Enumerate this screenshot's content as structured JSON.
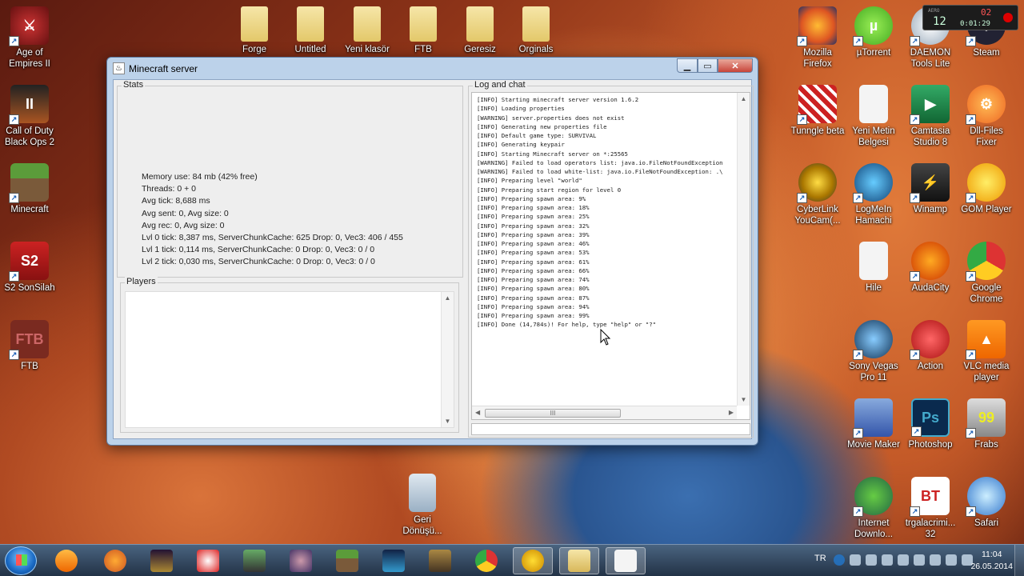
{
  "desktop": {
    "left_icons": [
      "Age of Empires II",
      "Call of Duty Black Ops 2",
      "Minecraft",
      "S2 SonSilah",
      "FTB"
    ],
    "top_folders": [
      "Forge",
      "Untitled",
      "Yeni klasör",
      "FTB",
      "Geresiz",
      "Orginals"
    ],
    "right_icons": [
      "Mozilla Firefox",
      "µTorrent",
      "DAEMON Tools Lite",
      "Steam",
      "Tunngle beta",
      "Yeni Metin Belgesi",
      "Camtasia Studio 8",
      "Dll-Files Fixer",
      "CyberLink YouCam(...",
      "LogMeIn Hamachi",
      "Winamp",
      "GOM Player",
      "Hile",
      "AudaCity",
      "Google Chrome",
      "Sony Vegas Pro 11",
      "Action",
      "VLC media player",
      "Movie Maker",
      "Photoshop",
      "Frabs",
      "Internet Downlo...",
      "trgalacrimi... 32",
      "Safari"
    ],
    "recycle_bin": "Geri Dönüşü..."
  },
  "recorder": {
    "label": "AERO",
    "fps": "12",
    "seconds": "02",
    "time": "0:01:29"
  },
  "window": {
    "title": "Minecraft server",
    "stats_label": "Stats",
    "stats": [
      "Memory use: 84 mb (42% free)",
      "Threads: 0 + 0",
      "Avg tick: 8,688 ms",
      "Avg sent: 0, Avg size: 0",
      "Avg rec: 0, Avg size: 0",
      "Lvl 0 tick: 8,387 ms, ServerChunkCache: 625 Drop: 0, Vec3: 406 / 455",
      "Lvl 1 tick: 0,114 ms, ServerChunkCache: 0 Drop: 0, Vec3: 0 / 0",
      "Lvl 2 tick: 0,030 ms, ServerChunkCache: 0 Drop: 0, Vec3: 0 / 0"
    ],
    "players_label": "Players",
    "log_label": "Log and chat",
    "log": [
      "[INFO] Starting minecraft server version 1.6.2",
      "[INFO] Loading properties",
      "[WARNING] server.properties does not exist",
      "[INFO] Generating new properties file",
      "[INFO] Default game type: SURVIVAL",
      "[INFO] Generating keypair",
      "[INFO] Starting Minecraft server on *:25565",
      "[WARNING] Failed to load operators list: java.io.FileNotFoundException",
      "[WARNING] Failed to load white-list: java.io.FileNotFoundException: .\\",
      "[INFO] Preparing level \"world\"",
      "[INFO] Preparing start region for level 0",
      "[INFO] Preparing spawn area: 9%",
      "[INFO] Preparing spawn area: 18%",
      "[INFO] Preparing spawn area: 25%",
      "[INFO] Preparing spawn area: 32%",
      "[INFO] Preparing spawn area: 39%",
      "[INFO] Preparing spawn area: 46%",
      "[INFO] Preparing spawn area: 53%",
      "[INFO] Preparing spawn area: 61%",
      "[INFO] Preparing spawn area: 66%",
      "[INFO] Preparing spawn area: 74%",
      "[INFO] Preparing spawn area: 80%",
      "[INFO] Preparing spawn area: 87%",
      "[INFO] Preparing spawn area: 94%",
      "[INFO] Preparing spawn area: 99%",
      "[INFO] Done (14,784s)! For help, type \"help\" or \"?\""
    ],
    "hscroll_grip": "III"
  },
  "taskbar": {
    "language": "TR",
    "time": "11:04",
    "date": "26.05.2014"
  }
}
